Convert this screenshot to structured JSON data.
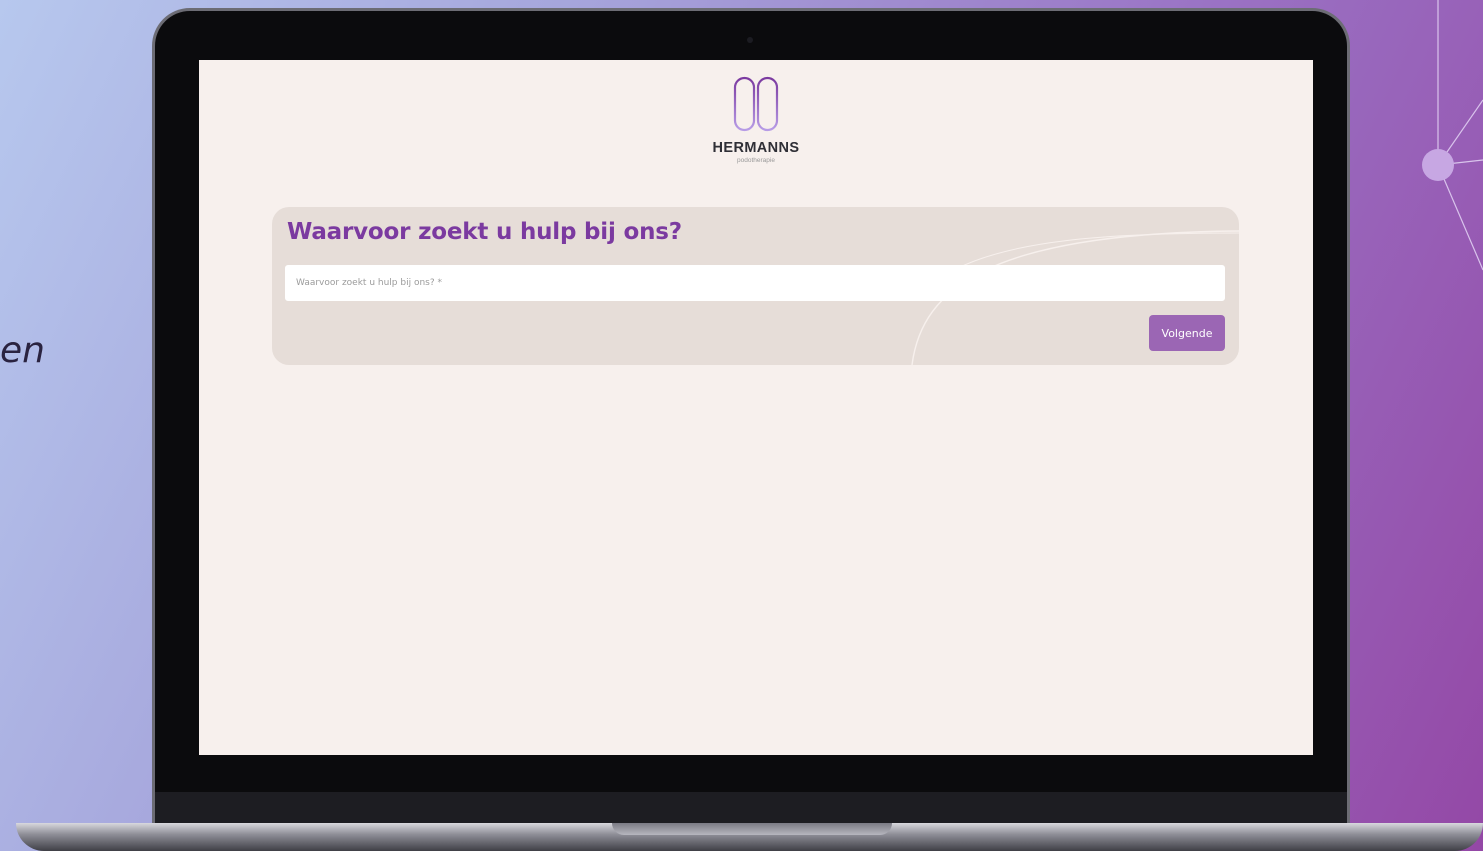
{
  "backdrop": {
    "side_text": "en"
  },
  "site": {
    "brand_name": "HERMANNS",
    "brand_tagline": "podotherapie",
    "logo_icon": "hermanns-logo-icon",
    "accent_color": "#7b3aa0",
    "button_color": "#9b66b4",
    "background_color": "#f7f0ed",
    "card_color": "#e6ddd8"
  },
  "form": {
    "title": "Waarvoor zoekt u hulp bij ons?",
    "input_placeholder": "Waarvoor zoekt u hulp bij ons? *",
    "input_value": "",
    "next_label": "Volgende"
  }
}
